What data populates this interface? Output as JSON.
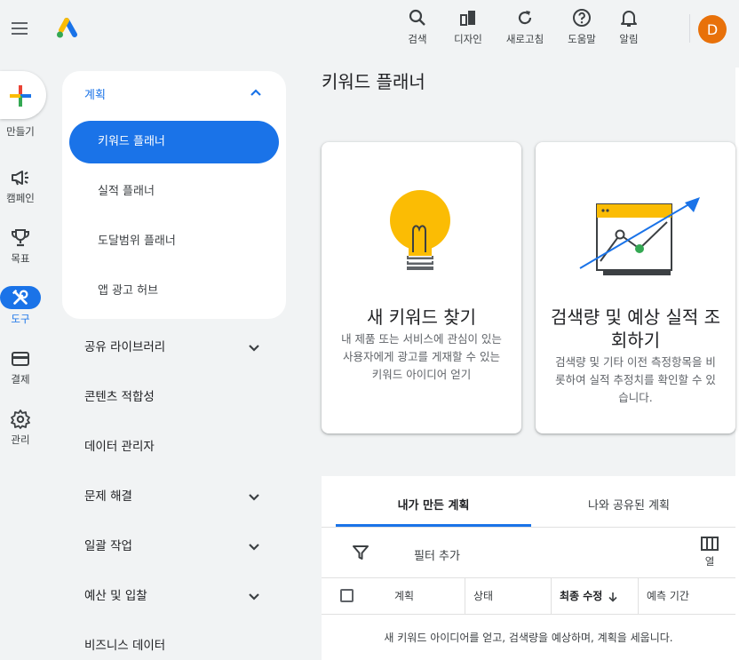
{
  "header": {
    "actions": [
      {
        "label": "검색",
        "icon": "search-icon"
      },
      {
        "label": "디자인",
        "icon": "design-icon"
      },
      {
        "label": "새로고침",
        "icon": "refresh-icon"
      },
      {
        "label": "도움말",
        "icon": "help-icon"
      },
      {
        "label": "알림",
        "icon": "bell-icon"
      }
    ],
    "avatar_letter": "D",
    "avatar_color": "#e8710a"
  },
  "rail": {
    "create_label": "만들기",
    "items": [
      {
        "label": "캠페인",
        "icon": "megaphone-icon"
      },
      {
        "label": "목표",
        "icon": "trophy-icon"
      },
      {
        "label": "도구",
        "icon": "tools-icon",
        "active": true
      },
      {
        "label": "결제",
        "icon": "credit-card-icon"
      },
      {
        "label": "관리",
        "icon": "gear-icon"
      }
    ]
  },
  "nav": {
    "section_label": "계획",
    "sub_items": [
      {
        "label": "키워드 플래너",
        "active": true
      },
      {
        "label": "실적 플래너"
      },
      {
        "label": "도달범위 플래너"
      },
      {
        "label": "앱 광고 허브"
      }
    ],
    "items": [
      {
        "label": "공유 라이브러리",
        "expandable": true
      },
      {
        "label": "콘텐츠 적합성",
        "expandable": false
      },
      {
        "label": "데이터 관리자",
        "expandable": false
      },
      {
        "label": "문제 해결",
        "expandable": true
      },
      {
        "label": "일괄 작업",
        "expandable": true
      },
      {
        "label": "예산 및 입찰",
        "expandable": true
      },
      {
        "label": "비즈니스 데이터",
        "expandable": false
      }
    ]
  },
  "main": {
    "title": "키워드 플래너",
    "cards": [
      {
        "title": "새 키워드 찾기",
        "description": "내 제품 또는 서비스에 관심이 있는 사용자에게 광고를 게재할 수 있는 키워드 아이디어 얻기",
        "icon": "lightbulb-illustration"
      },
      {
        "title": "검색량 및 예상 실적 조회하기",
        "description": "검색량 및 기타 이전 측정항목을 비롯하여 실적 추정치를 확인할 수 있습니다.",
        "icon": "trend-chart-illustration"
      }
    ],
    "plans": {
      "tabs": [
        {
          "label": "내가 만든 계획",
          "active": true
        },
        {
          "label": "나와 공유된 계획"
        }
      ],
      "filter_label": "필터 추가",
      "columns_label": "열",
      "columns": [
        "계획",
        "상태",
        "최종 수정",
        "예측 기간"
      ],
      "sorted_column": "최종 수정",
      "empty_message": "새 키워드 아이디어를 얻고, 검색량을 예상하며, 계획을 세웁니다."
    }
  },
  "colors": {
    "accent": "#1a73e8",
    "background": "#f1f3f4",
    "bulb": "#fbbc04",
    "chart_dot": "#34a853"
  }
}
